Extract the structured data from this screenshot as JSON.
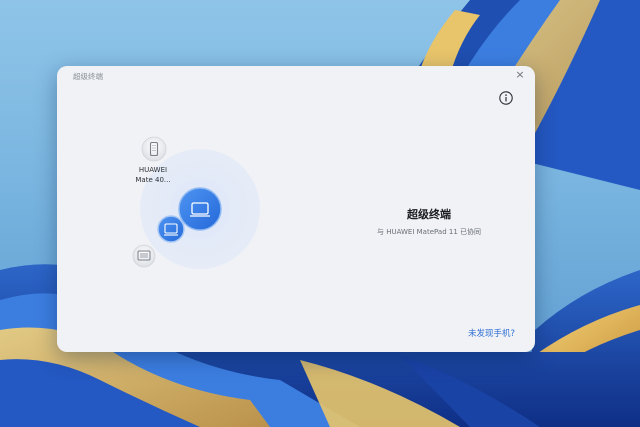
{
  "dialog": {
    "title": "超级终端",
    "close_glyph": "×",
    "info_icon": "info-circle-icon"
  },
  "devices": {
    "phone": {
      "label_line1": "HUAWEI",
      "label_line2": "Mate 40...",
      "icon": "phone-icon"
    },
    "center_device": {
      "icon": "tablet-icon"
    },
    "connected_device": {
      "icon": "laptop-icon"
    },
    "monitor_device": {
      "icon": "monitor-icon"
    }
  },
  "status": {
    "title": "超级终端",
    "subtitle": "与 HUAWEI MatePad 11 已协同"
  },
  "help_link": "未发现手机?",
  "colors": {
    "accent": "#2f6fd6",
    "dialog_bg": "#f0f2f5",
    "device_blue": "#3b82e8"
  }
}
